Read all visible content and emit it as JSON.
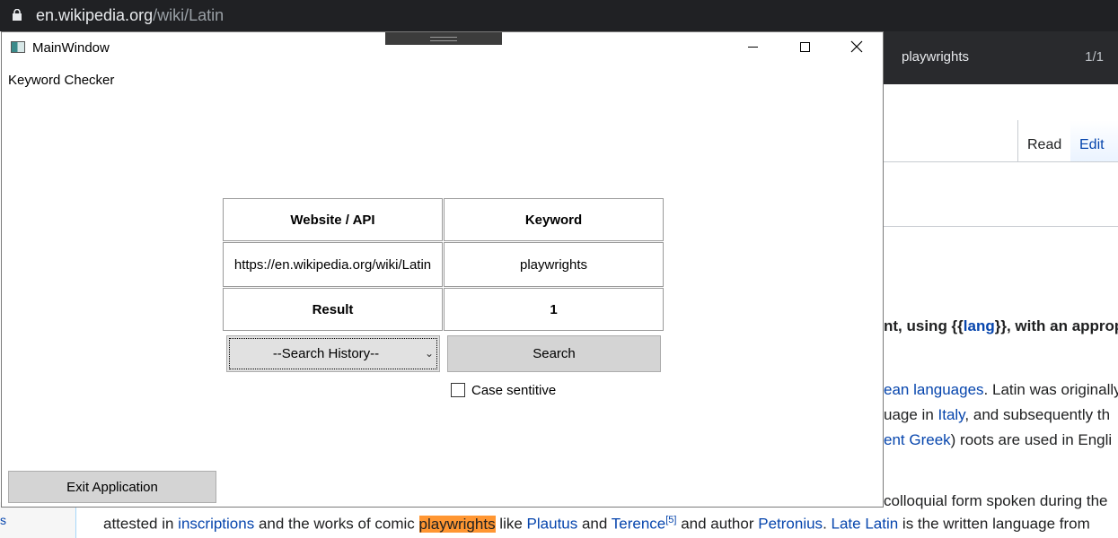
{
  "browser": {
    "url_host": "en.wikipedia.org",
    "url_path": "/wiki/Latin",
    "find_query": "playwrights",
    "find_count": "1/1"
  },
  "wiki": {
    "tab_read": "Read",
    "tab_edit": "Edit",
    "bold_prefix": "nt, using {{",
    "bold_link": "lang",
    "bold_suffix": "}}, with an approp",
    "para1_link": "ean languages",
    "para1_text": ". Latin was originally",
    "para2_text1": "uage in ",
    "para2_link": "Italy",
    "para2_text2": ", and subsequently th",
    "para3_link": "ent Greek",
    "para3_text": ") roots are used in Engli",
    "colloquial_text": "colloquial form spoken during the",
    "bottom_t1": "attested in ",
    "bottom_l1": "inscriptions",
    "bottom_t2": " and the works of comic ",
    "bottom_hl": "playwrights",
    "bottom_t3": " like ",
    "bottom_l2": "Plautus",
    "bottom_t4": " and ",
    "bottom_l3": "Terence",
    "bottom_sup": "[5]",
    "bottom_t5": " and author ",
    "bottom_l4": "Petronius",
    "bottom_t6": ". ",
    "bottom_l5": "Late Latin",
    "bottom_t7": " is the written language from",
    "sidebar_text": "s"
  },
  "window": {
    "title": "MainWindow",
    "heading": "Keyword Checker"
  },
  "table": {
    "header_website": "Website / API",
    "header_keyword": "Keyword",
    "website_value": "https://en.wikipedia.org/wiki/Latin",
    "keyword_value": "playwrights",
    "result_label": "Result",
    "result_value": "1"
  },
  "controls": {
    "history_label": "--Search History--",
    "search_label": "Search",
    "case_label": "Case sentitive",
    "case_checked": false,
    "exit_label": "Exit Application"
  }
}
